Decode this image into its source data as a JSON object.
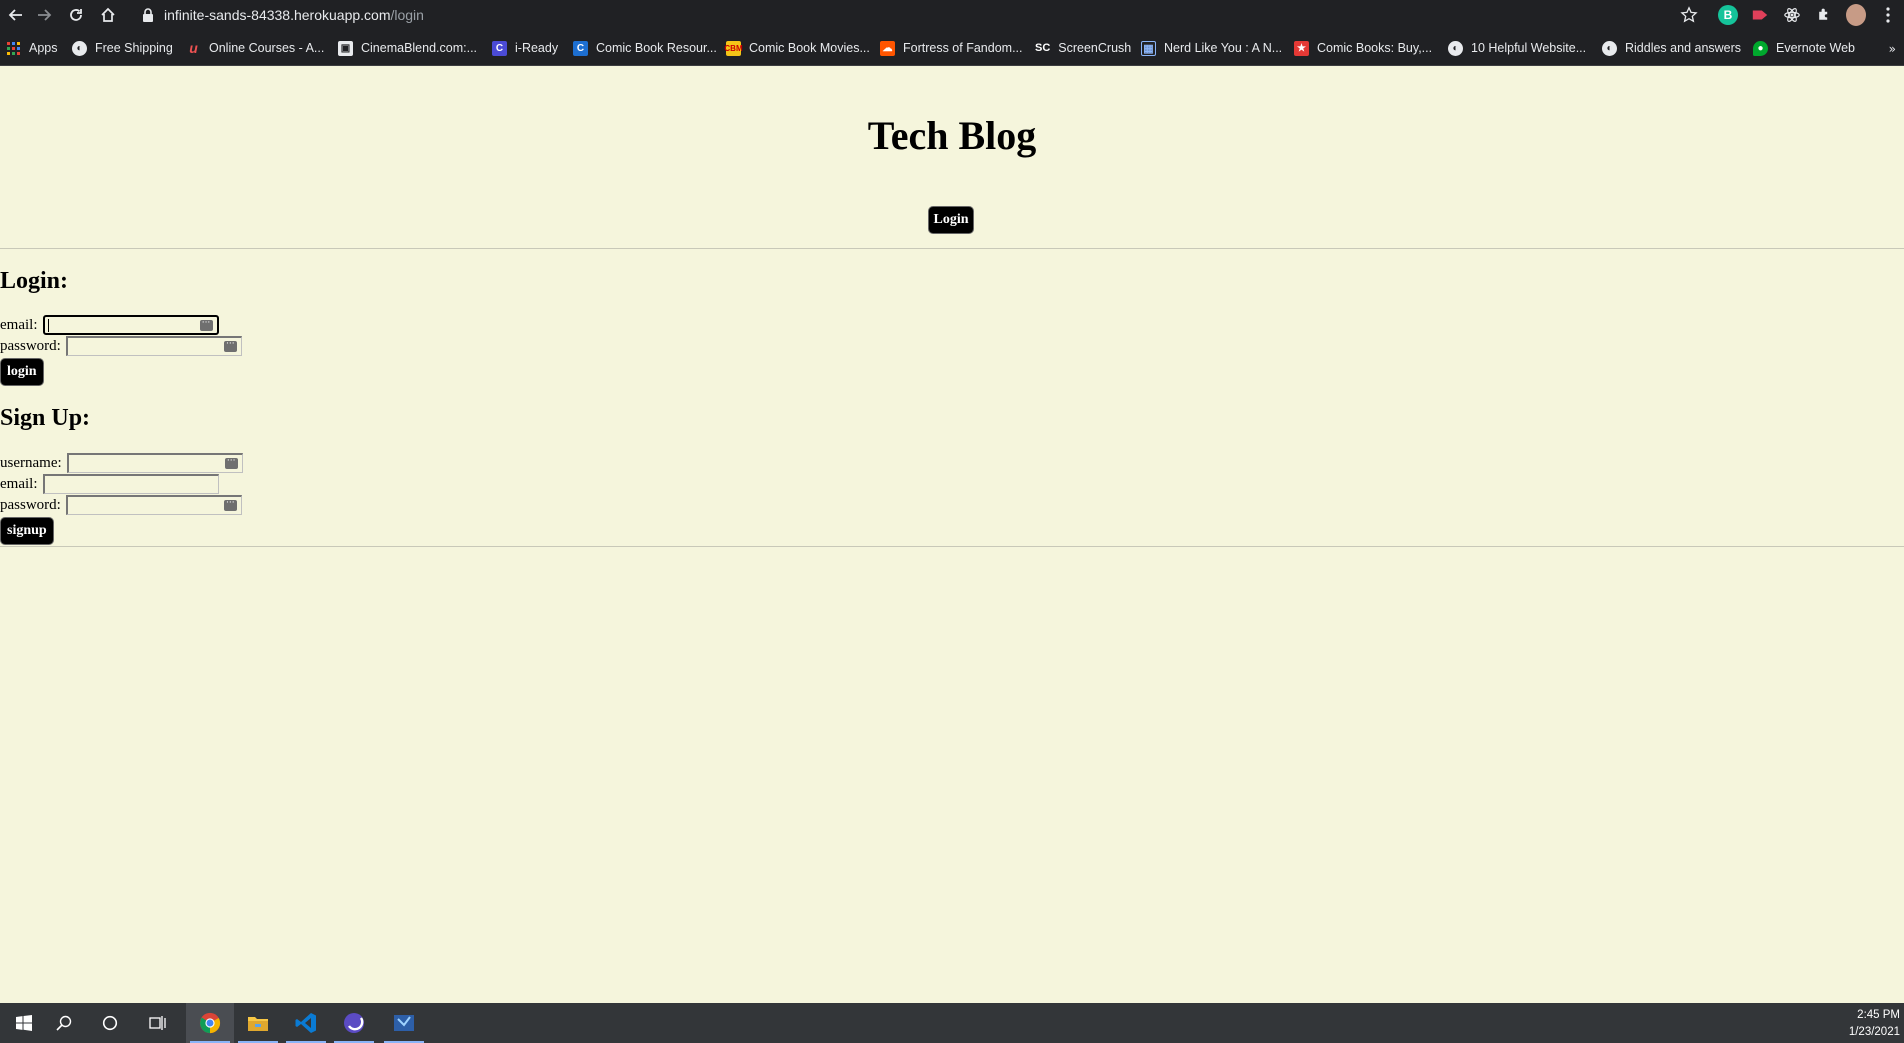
{
  "browser": {
    "url_host": "infinite-sands-84338.herokuapp.com",
    "url_path": "/login",
    "extension_badge": "B"
  },
  "bookmarks": [
    {
      "label": "Apps",
      "icon": "apps-grid-icon"
    },
    {
      "label": "Free Shipping",
      "icon": "globe-icon"
    },
    {
      "label": "Online Courses - A...",
      "icon": "udemy-icon"
    },
    {
      "label": "CinemaBlend.com:...",
      "icon": "cinemablend-icon"
    },
    {
      "label": "i-Ready",
      "icon": "iready-icon"
    },
    {
      "label": "Comic Book Resour...",
      "icon": "cbr-icon"
    },
    {
      "label": "Comic Book Movies...",
      "icon": "cbm-icon"
    },
    {
      "label": "Fortress of Fandom...",
      "icon": "soundcloud-icon"
    },
    {
      "label": "ScreenCrush",
      "icon": "screencrush-icon"
    },
    {
      "label": "Nerd Like You : A N...",
      "icon": "grid-icon"
    },
    {
      "label": "Comic Books: Buy,...",
      "icon": "comics-icon"
    },
    {
      "label": "10 Helpful Website...",
      "icon": "globe-icon"
    },
    {
      "label": "Riddles and answers",
      "icon": "globe-icon"
    },
    {
      "label": "Evernote Web",
      "icon": "evernote-icon"
    }
  ],
  "page": {
    "title": "Tech Blog",
    "nav_login": "Login",
    "login": {
      "heading": "Login:",
      "email_label": "email:",
      "password_label": "password:",
      "email_value": "",
      "password_value": "",
      "button": "login"
    },
    "signup": {
      "heading": "Sign Up:",
      "username_label": "username:",
      "email_label": "email:",
      "password_label": "password:",
      "username_value": "",
      "email_value": "",
      "password_value": "",
      "button": "signup"
    }
  },
  "taskbar": {
    "time": "2:45 PM",
    "date": "1/23/2021"
  },
  "colors": {
    "page_background": "#f5f5dc",
    "button_background": "#000000",
    "chrome_background": "#202124",
    "taskbar_background": "#333639"
  }
}
